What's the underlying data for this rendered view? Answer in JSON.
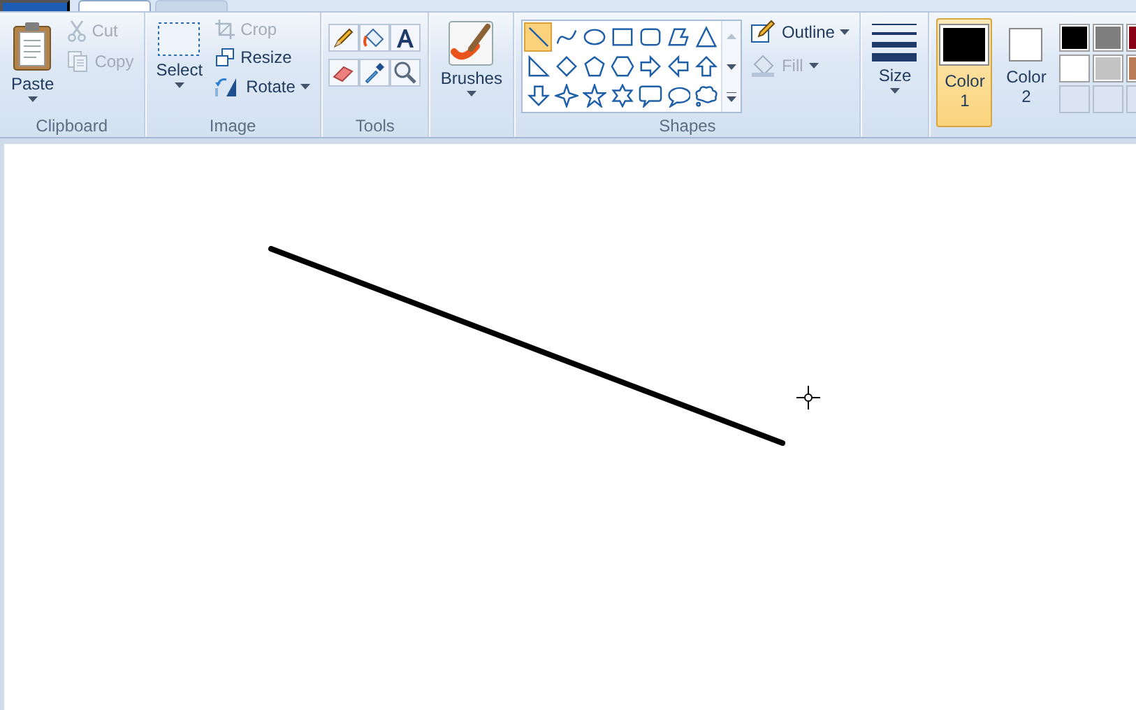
{
  "tabs": [
    {
      "kind": "app"
    },
    {
      "kind": "tab",
      "selected": true
    },
    {
      "kind": "tab",
      "selected": false
    }
  ],
  "clipboard": {
    "label": "Clipboard",
    "paste": "Paste",
    "cut": {
      "label": "Cut",
      "disabled": true
    },
    "copy": {
      "label": "Copy",
      "disabled": true
    }
  },
  "image": {
    "label": "Image",
    "select": "Select",
    "crop": {
      "label": "Crop",
      "disabled": true
    },
    "resize": {
      "label": "Resize",
      "disabled": false
    },
    "rotate": {
      "label": "Rotate",
      "disabled": false
    }
  },
  "tools": {
    "label": "Tools",
    "items": [
      {
        "kind": "pencil",
        "selected": false
      },
      {
        "kind": "fill",
        "selected": false
      },
      {
        "kind": "text",
        "selected": false
      },
      {
        "kind": "eraser",
        "selected": false
      },
      {
        "kind": "picker",
        "selected": false
      },
      {
        "kind": "magnifier",
        "selected": false
      }
    ]
  },
  "brushes": {
    "label": "Brushes"
  },
  "shapes": {
    "label": "Shapes",
    "items": [
      {
        "kind": "line",
        "selected": true
      },
      {
        "kind": "curve",
        "selected": false
      },
      {
        "kind": "oval",
        "selected": false
      },
      {
        "kind": "rectangle",
        "selected": false
      },
      {
        "kind": "rounded-rectangle",
        "selected": false
      },
      {
        "kind": "polygon",
        "selected": false
      },
      {
        "kind": "triangle",
        "selected": false
      },
      {
        "kind": "right-triangle",
        "selected": false
      },
      {
        "kind": "diamond",
        "selected": false
      },
      {
        "kind": "pentagon",
        "selected": false
      },
      {
        "kind": "hexagon",
        "selected": false
      },
      {
        "kind": "right-arrow",
        "selected": false
      },
      {
        "kind": "left-arrow",
        "selected": false
      },
      {
        "kind": "up-arrow",
        "selected": false
      },
      {
        "kind": "down-arrow",
        "selected": false
      },
      {
        "kind": "four-point-star",
        "selected": false
      },
      {
        "kind": "five-point-star",
        "selected": false
      },
      {
        "kind": "six-point-star",
        "selected": false
      },
      {
        "kind": "rounded-callout",
        "selected": false
      },
      {
        "kind": "oval-callout",
        "selected": false
      },
      {
        "kind": "cloud-callout",
        "selected": false
      }
    ],
    "outline": {
      "label": "Outline",
      "disabled": false
    },
    "fill": {
      "label": "Fill",
      "disabled": true
    }
  },
  "size": {
    "label": "Size"
  },
  "colors": [
    {
      "label": "Color 1",
      "color": "#000000",
      "selected": true
    },
    {
      "label": "Color 2",
      "color": "#ffffff",
      "selected": false
    }
  ],
  "palette": [
    {
      "kind": "swatch",
      "color": "#000000"
    },
    {
      "kind": "swatch",
      "color": "#7f7f7f"
    },
    {
      "kind": "swatch",
      "color": "#880015"
    },
    {
      "kind": "swatch",
      "color": "#ffffff"
    },
    {
      "kind": "swatch",
      "color": "#c3c3c3"
    },
    {
      "kind": "swatch",
      "color": "#b97a57"
    },
    {
      "kind": "empty"
    },
    {
      "kind": "empty"
    },
    {
      "kind": "empty"
    }
  ]
}
